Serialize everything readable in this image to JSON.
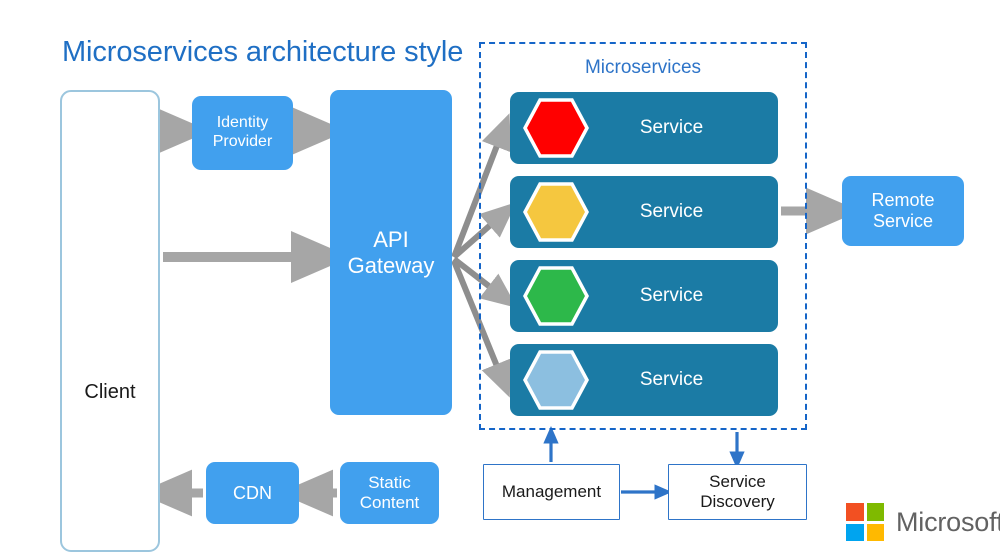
{
  "title": "Microservices architecture style",
  "colors": {
    "title_blue": "#1F6FC4",
    "node_blue": "#41A0EE",
    "service_teal": "#1B7BA5",
    "dashed_border_blue": "#1565C8",
    "arrow_gray": "#A6A6A6",
    "arrow_blue": "#2E74C8",
    "client_border": "#9CC6DE"
  },
  "nodes": {
    "client": {
      "label": "Client"
    },
    "identity_provider": {
      "label": "Identity Provider",
      "line1": "Identity",
      "line2": "Provider"
    },
    "api_gateway": {
      "label": "API Gateway",
      "line1": "API",
      "line2": "Gateway"
    },
    "cdn": {
      "label": "CDN"
    },
    "static_content": {
      "label": "Static Content",
      "line1": "Static",
      "line2": "Content"
    },
    "remote_service": {
      "label": "Remote Service",
      "line1": "Remote",
      "line2": "Service"
    },
    "management": {
      "label": "Management"
    },
    "service_discovery": {
      "label": "Service Discovery",
      "line1": "Service",
      "line2": "Discovery"
    }
  },
  "microservices": {
    "group_label": "Microservices",
    "services": [
      {
        "label": "Service",
        "hex_color": "#FF0000",
        "icon": "hexagon-icon"
      },
      {
        "label": "Service",
        "hex_color": "#F5C73F",
        "icon": "hexagon-icon"
      },
      {
        "label": "Service",
        "hex_color": "#2DB84A",
        "icon": "hexagon-icon"
      },
      {
        "label": "Service",
        "hex_color": "#8CBFE0",
        "icon": "hexagon-icon"
      }
    ]
  },
  "brand": {
    "name": "Microsoft",
    "logo_squares": [
      "#F25022",
      "#7FBA00",
      "#00A4EF",
      "#FFB900"
    ]
  }
}
